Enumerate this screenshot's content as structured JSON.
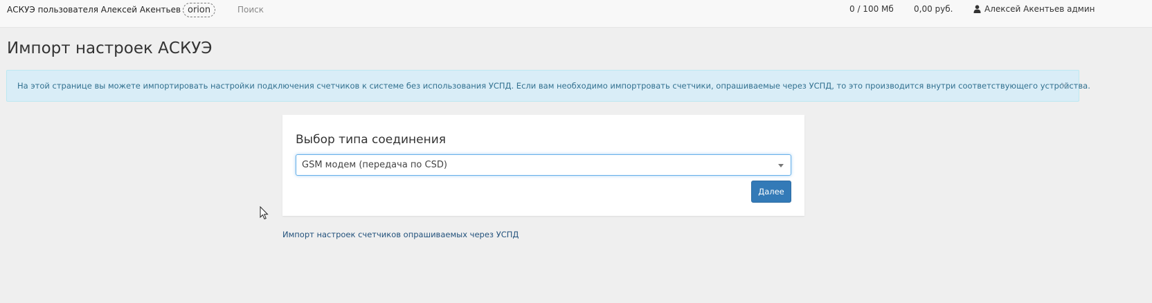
{
  "navbar": {
    "title": "АСКУЭ пользователя Алексей Акентьев",
    "server": "orion",
    "search": "Поиск",
    "storage": "0 / 100 Мб",
    "balance": "0,00 руб.",
    "user": "Алексей Акентьев админ",
    "user_icon": "user-icon"
  },
  "page": {
    "title": "Импорт настроек АСКУЭ"
  },
  "alert": {
    "text": "На этой странице вы можете импортировать настройки подключения счетчиков к системе без использования УСПД. Если вам необходимо импортровать счетчики, опрашиваемые через УСПД, то это производится внутри соответствующего устройства.",
    "close": "×"
  },
  "panel": {
    "heading": "Выбор типа соединения",
    "select_value": "GSM модем (передача по CSD)",
    "next_label": "Далее"
  },
  "link": {
    "text": "Импорт настроек счетчиков опрашиваемых через УСПД"
  },
  "colors": {
    "background": "#efefef",
    "alert_bg": "#d9edf7",
    "alert_text": "#31708f",
    "primary": "#337ab7",
    "link": "#23527c"
  }
}
